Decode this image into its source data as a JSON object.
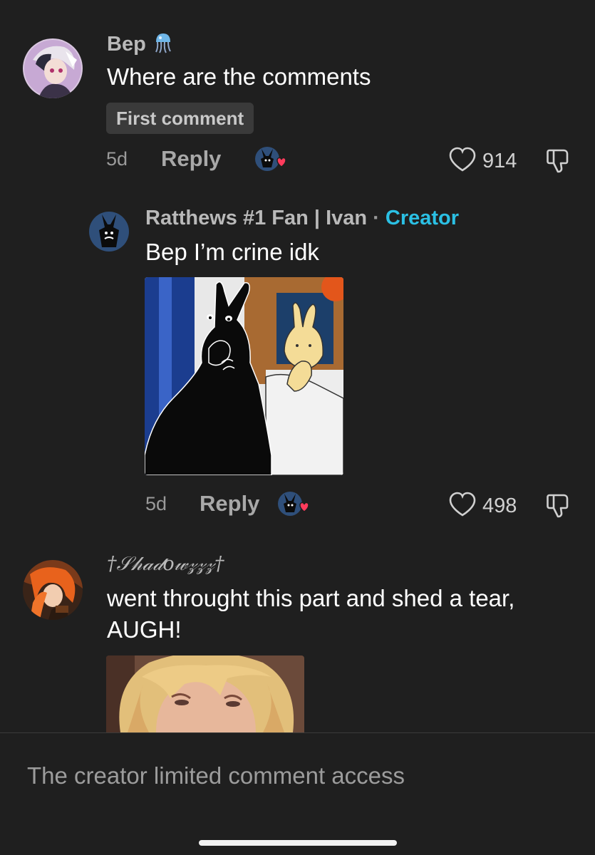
{
  "comments": [
    {
      "username": "Bep",
      "username_icon": "jellyfish-icon",
      "text": "Where are the comments",
      "tag": "First comment",
      "time": "5d",
      "reply_label": "Reply",
      "likes": "914",
      "avatar": "anime-character-avatar"
    },
    {
      "username": "Ratthews #1 Fan | Ivan",
      "separator": "·",
      "badge": "Creator",
      "text": "Bep I’m crine idk",
      "time": "5d",
      "reply_label": "Reply",
      "likes": "498",
      "avatar": "black-rabbit-avatar",
      "image": "two-rabbits-crying-cartoon"
    },
    {
      "username": "†𝒮𝒽𝒶𝒹𝑜𝓌𝓏𝓏𝓏†",
      "text_line1": "went throught this part and shed a tear,",
      "text_line2": "AUGH!",
      "avatar": "orange-haired-character-avatar",
      "image": "crying-blonde-woman-photo"
    }
  ],
  "footer": {
    "text": "The creator limited comment access"
  },
  "colors": {
    "background": "#1f1f1f",
    "creator_badge": "#2bc0e4",
    "heart_badge": "#ff3b5c"
  }
}
